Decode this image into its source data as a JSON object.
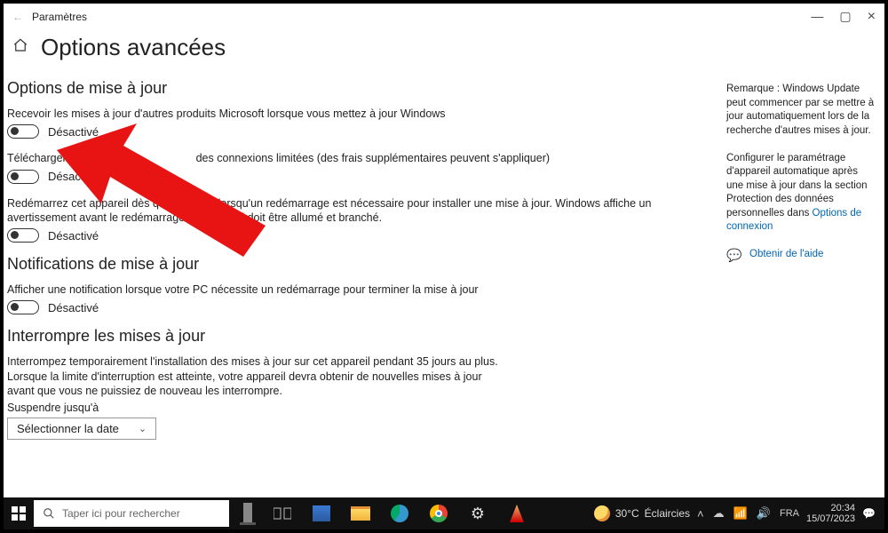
{
  "window": {
    "app_name": "Paramètres",
    "title": "Options avancées"
  },
  "sections": {
    "update_options": {
      "heading": "Options de mise à jour",
      "opt1_desc": "Recevoir les mises à jour d'autres produits Microsoft lorsque vous mettez à jour Windows",
      "opt1_state": "Désactivé",
      "opt2_desc_a": "Télécharger les mises",
      "opt2_desc_b": "des connexions limitées (des frais supplémentaires peuvent s'appliquer)",
      "opt2_state": "Désactivé",
      "opt3_desc": "Redémarrez cet appareil dès que possible lorsqu'un redémarrage est nécessaire pour installer une mise à jour. Windows affiche un avertissement avant le redémarrage et l'appareil doit être allumé et branché.",
      "opt3_state": "Désactivé"
    },
    "notifications": {
      "heading": "Notifications de mise à jour",
      "desc": "Afficher une notification lorsque votre PC nécessite un redémarrage pour terminer la mise à jour",
      "state": "Désactivé"
    },
    "pause": {
      "heading": "Interrompre les mises à jour",
      "desc": "Interrompez temporairement l'installation des mises à jour sur cet appareil pendant 35 jours au plus. Lorsque la limite d'interruption est atteinte, votre appareil devra obtenir de nouvelles mises à jour avant que vous ne puissiez de nouveau les interrompre.",
      "suspend_label": "Suspendre jusqu'à",
      "dropdown": "Sélectionner la date"
    }
  },
  "sidepanel": {
    "note1": "Remarque : Windows Update peut commencer par se mettre à jour automatiquement lors de la recherche d'autres mises à jour.",
    "note2": "Configurer le paramétrage d'appareil automatique après une mise à jour dans la section Protection des données personnelles dans",
    "link": "Options de connexion",
    "help": "Obtenir de l'aide"
  },
  "taskbar": {
    "search_placeholder": "Taper ici pour rechercher",
    "weather_temp": "30°C",
    "weather_text": "Éclaircies",
    "time": "20:34",
    "date": "15/07/2023"
  }
}
